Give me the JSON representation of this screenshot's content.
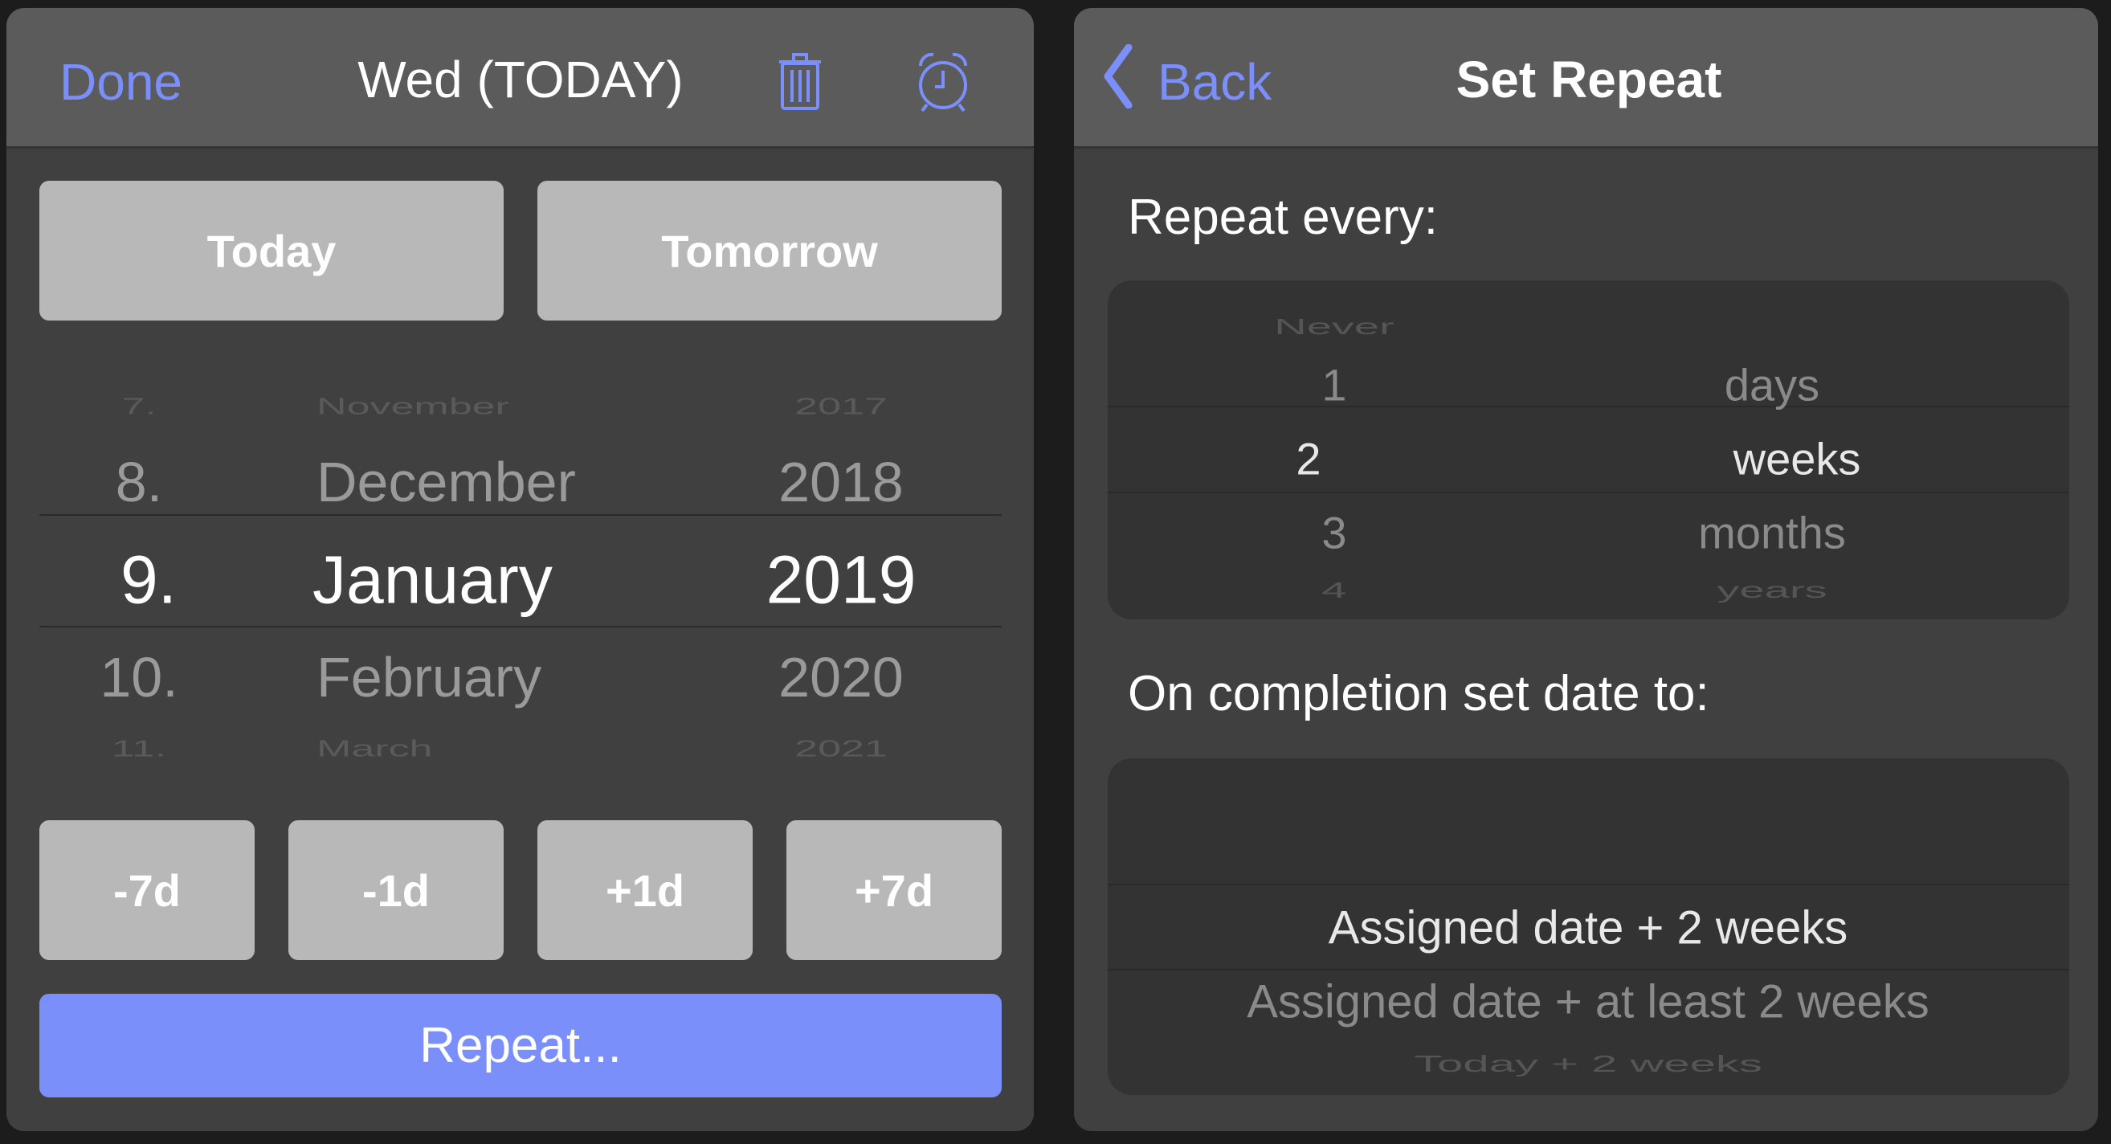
{
  "date_panel": {
    "done_label": "Done",
    "title": "Wed (TODAY)",
    "trash_icon": "trash-icon",
    "alarm_icon": "alarm-clock-icon",
    "quick": [
      "Today",
      "Tomorrow"
    ],
    "picker": {
      "days": [
        "7.",
        "8.",
        "9.",
        "10.",
        "11."
      ],
      "months": [
        "November",
        "December",
        "January",
        "February",
        "March"
      ],
      "years": [
        "2017",
        "2018",
        "2019",
        "2020",
        "2021"
      ],
      "selected_index": 2
    },
    "shift": [
      "-7d",
      "-1d",
      "+1d",
      "+7d"
    ],
    "repeat_label": "Repeat..."
  },
  "repeat_panel": {
    "back_label": "Back",
    "title": "Set Repeat",
    "repeat_every_label": "Repeat every:",
    "numbers": [
      "Never",
      "1",
      "2",
      "3",
      "4"
    ],
    "units": [
      "days",
      "weeks",
      "months",
      "years"
    ],
    "selected_number": "2",
    "selected_unit": "weeks",
    "completion_label": "On completion set date to:",
    "completion_options": [
      "Assigned date + 2 weeks",
      "Assigned date + at least 2 weeks",
      "Today + 2 weeks"
    ],
    "selected_completion": "Assigned date + 2 weeks"
  },
  "colors": {
    "accent": "#7b8ffb",
    "header": "#5b5b5b",
    "body": "#404040",
    "button": "#b8b8b8",
    "picker": "#333333"
  }
}
